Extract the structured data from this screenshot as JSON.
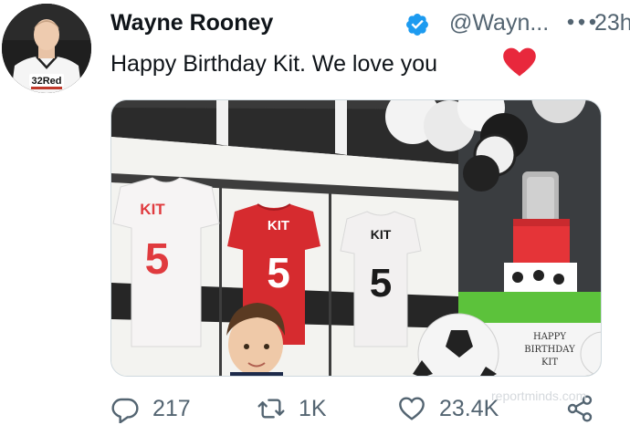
{
  "tweet": {
    "author_name": "Wayne Rooney",
    "handle": "@Wayn...",
    "separator": "·",
    "time": "23h",
    "text": "Happy Birthday Kit. We love you",
    "verified_icon": "verified-badge-icon",
    "more_icon": "more-dots-icon",
    "heart_emoji": "red-heart-icon",
    "avatar_jersey_text": "32Red"
  },
  "media": {
    "shirts": [
      {
        "name": "KIT",
        "number": "5",
        "color": "#f4f1f1",
        "text_color": "#e03a3e"
      },
      {
        "name": "KIT",
        "number": "5",
        "color": "#d62b2f",
        "text_color": "#ffffff"
      },
      {
        "name": "KIT",
        "number": "5",
        "color": "#f2f0f0",
        "text_color": "#1a1a1a"
      }
    ],
    "cake_text": [
      "HAPPY",
      "BIRTHDAY",
      "KIT"
    ]
  },
  "actions": {
    "reply_count": "217",
    "retweet_count": "1K",
    "like_count": "23.4K",
    "reply_icon": "reply-icon",
    "retweet_icon": "retweet-icon",
    "like_icon": "like-heart-icon",
    "share_icon": "share-icon"
  },
  "watermark": "reportminds.com",
  "colors": {
    "accent": "#1d9bf0",
    "muted": "#536471",
    "heart": "#e0245e"
  }
}
